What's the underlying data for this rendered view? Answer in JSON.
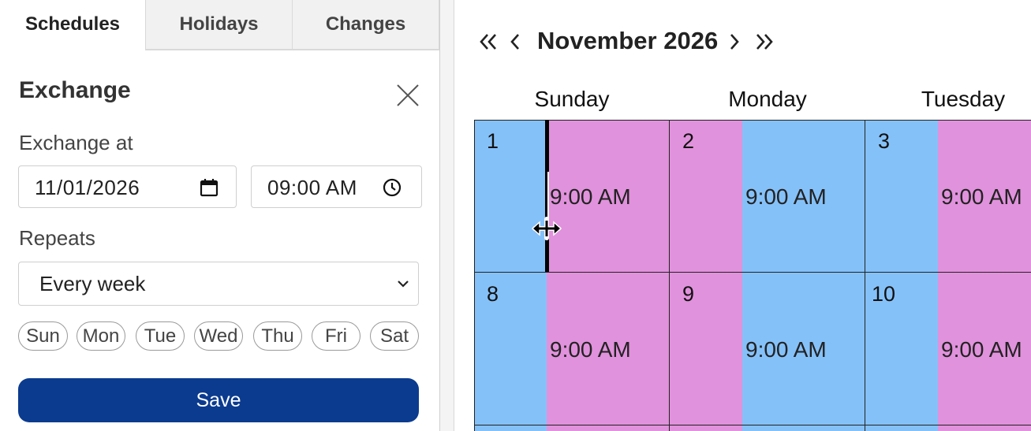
{
  "tabs": [
    {
      "label": "Schedules",
      "active": true
    },
    {
      "label": "Holidays",
      "active": false
    },
    {
      "label": "Changes",
      "active": false
    }
  ],
  "panel": {
    "title": "Exchange",
    "exchange_at_label": "Exchange at",
    "date_value": "11/01/2026",
    "time_value": "09:00 AM",
    "repeats_label": "Repeats",
    "repeats_value": "Every week",
    "days": [
      "Sun",
      "Mon",
      "Tue",
      "Wed",
      "Thu",
      "Fri",
      "Sat"
    ],
    "save_label": "Save"
  },
  "calendar": {
    "month_title": "November 2026",
    "weekdays": [
      "Sunday",
      "Monday",
      "Tuesday"
    ],
    "weeks": [
      [
        {
          "day": "1",
          "time": "9:00 AM",
          "left_color": "#85c1f9",
          "right_color": "#e192dc"
        },
        {
          "day": "2",
          "time": "9:00 AM",
          "left_color": "#e192dc",
          "right_color": "#85c1f9"
        },
        {
          "day": "3",
          "time": "9:00 AM",
          "left_color": "#85c1f9",
          "right_color": "#e192dc"
        }
      ],
      [
        {
          "day": "8",
          "time": "9:00 AM",
          "left_color": "#85c1f9",
          "right_color": "#e192dc"
        },
        {
          "day": "9",
          "time": "9:00 AM",
          "left_color": "#e192dc",
          "right_color": "#85c1f9"
        },
        {
          "day": "10",
          "time": "9:00 AM",
          "left_color": "#85c1f9",
          "right_color": "#e192dc"
        }
      ]
    ]
  },
  "colors": {
    "parent_a": "#85c1f9",
    "parent_b": "#e192dc",
    "save_button": "#0b3b8f"
  },
  "icons": [
    "close-icon",
    "calendar-icon",
    "clock-icon",
    "chevron-down-icon",
    "double-chevron-left-icon",
    "chevron-left-icon",
    "chevron-right-icon",
    "double-chevron-right-icon",
    "move-cursor-icon"
  ]
}
